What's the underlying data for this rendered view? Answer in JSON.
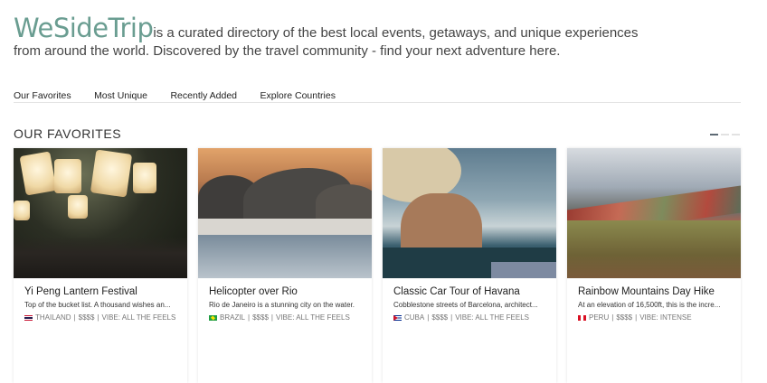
{
  "header": {
    "logo": "WeSideTrip",
    "tagline_line1": "is a curated directory of the best local events, getaways, and unique experiences",
    "tagline_line2": "from around the world. Discovered by the travel community - find your next adventure here."
  },
  "nav": {
    "items": [
      {
        "label": "Our Favorites"
      },
      {
        "label": "Most Unique"
      },
      {
        "label": "Recently Added"
      },
      {
        "label": "Explore Countries"
      }
    ]
  },
  "section": {
    "title": "OUR FAVORITES",
    "pager_active_index": 0,
    "pager_count": 3
  },
  "cards": [
    {
      "title": "Yi Peng Lantern Festival",
      "desc": "Top of the bucket list. A thousand wishes an...",
      "country": "THAILAND",
      "price": "$$$$",
      "vibe": "VIBE: ALL THE FEELS",
      "flag": "thailand-flag-icon"
    },
    {
      "title": "Helicopter over Rio",
      "desc": "Rio de Janeiro is a stunning city on the water.",
      "country": "BRAZIL",
      "price": "$$$$",
      "vibe": "VIBE: ALL THE FEELS",
      "flag": "brazil-flag-icon"
    },
    {
      "title": "Classic Car Tour of Havana",
      "desc": "Cobblestone streets of Barcelona, architect...",
      "country": "CUBA",
      "price": "$$$$",
      "vibe": "VIBE: ALL THE FEELS",
      "flag": "cuba-flag-icon"
    },
    {
      "title": "Rainbow Mountains Day Hike",
      "desc": "At an elevation of 16,500ft, this is the incre...",
      "country": "PERU",
      "price": "$$$$",
      "vibe": "VIBE: INTENSE",
      "flag": "peru-flag-icon"
    }
  ],
  "colors": {
    "logo": "#6a9d91",
    "pager_active": "#5e6a74",
    "pager_inactive": "#e2e2e2"
  }
}
